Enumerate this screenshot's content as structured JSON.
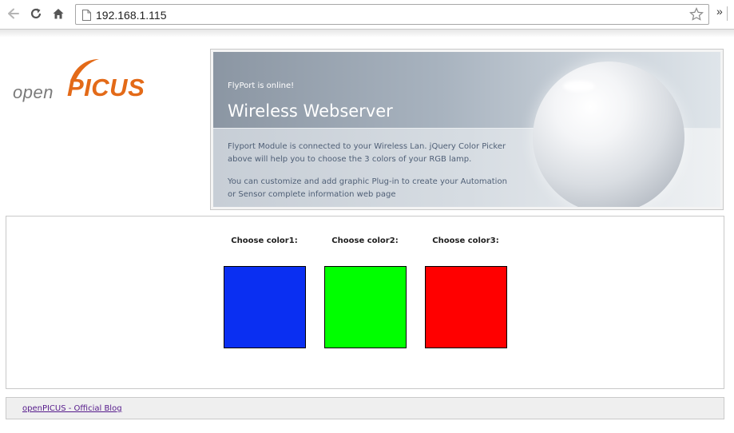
{
  "browser": {
    "url": "192.168.1.115",
    "icons": {
      "back": "back-arrow-icon",
      "reload": "reload-icon",
      "home": "home-icon",
      "page": "page-icon",
      "bookmark": "star-icon"
    },
    "overflow_label": "»"
  },
  "logo": {
    "prefix": "open",
    "name": "PICUS",
    "color": "#e36a18"
  },
  "banner": {
    "status": "FlyPort is online!",
    "title": "Wireless Webserver",
    "paragraph1": "Flyport Module is connected to your Wireless Lan. jQuery Color Picker above will help you to choose the 3 colors of your RGB lamp.",
    "paragraph2": "You can customize and add graphic Plug-in to create your Automation or Sensor complete information web page"
  },
  "pickers": [
    {
      "label": "Choose color1:",
      "color": "#0a2ff2"
    },
    {
      "label": "Choose color2:",
      "color": "#00ff00"
    },
    {
      "label": "Choose color3:",
      "color": "#ff0000"
    }
  ],
  "footer": {
    "link_text": "openPICUS - Official Blog"
  }
}
